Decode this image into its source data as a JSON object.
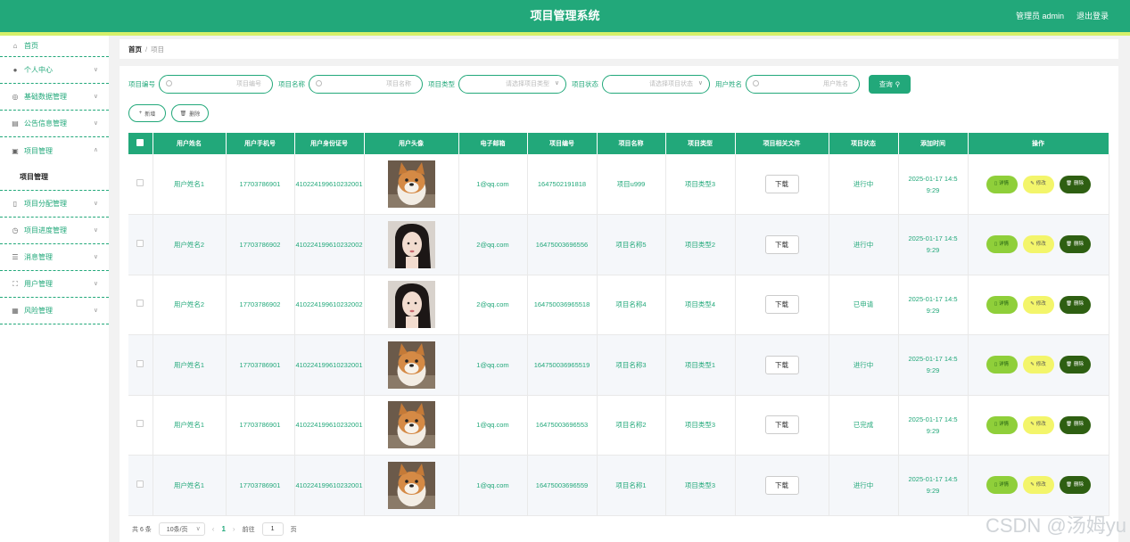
{
  "header": {
    "title": "项目管理系统",
    "user_label": "管理员 admin",
    "logout_label": "退出登录"
  },
  "sidebar": {
    "items": [
      {
        "label": "首页"
      },
      {
        "label": "个人中心"
      },
      {
        "label": "基础数据管理"
      },
      {
        "label": "公告信息管理"
      },
      {
        "label": "项目管理",
        "sub": "项目管理"
      },
      {
        "label": "项目分配管理"
      },
      {
        "label": "项目进度管理"
      },
      {
        "label": "消息管理"
      },
      {
        "label": "用户管理"
      },
      {
        "label": "风险管理"
      }
    ]
  },
  "breadcrumb": {
    "home": "首页",
    "sep": "/",
    "current": "项目"
  },
  "search": {
    "project_no_label": "项目编号",
    "project_no_placeholder": "项目编号",
    "project_name_label": "项目名称",
    "project_name_placeholder": "项目名称",
    "project_type_label": "项目类型",
    "project_type_placeholder": "请选择项目类型",
    "project_status_label": "项目状态",
    "project_status_placeholder": "请选择项目状态",
    "user_name_label": "用户姓名",
    "user_name_placeholder": "用户姓名",
    "query_label": "查询"
  },
  "actions": {
    "add_label": "新增",
    "delete_label": "删除"
  },
  "table": {
    "columns": [
      "用户姓名",
      "用户手机号",
      "用户身份证号",
      "用户头像",
      "电子邮箱",
      "项目编号",
      "项目名称",
      "项目类型",
      "项目相关文件",
      "项目状态",
      "添加时间",
      "操作"
    ],
    "download_label": "下载",
    "op_detail": "详情",
    "op_edit": "修改",
    "op_delete": "删除",
    "rows": [
      {
        "name": "用户姓名1",
        "phone": "17703786901",
        "id_card": "410224199610232001",
        "avatar": "shiba-dog-photo",
        "email": "1@qq.com",
        "project_no": "1647502191818",
        "project_name": "项目u999",
        "project_type": "项目类型3",
        "status": "进行中",
        "time": "2025-01-17 14:59:29"
      },
      {
        "name": "用户姓名2",
        "phone": "17703786902",
        "id_card": "410224199610232002",
        "avatar": "girl-portrait-photo",
        "email": "2@qq.com",
        "project_no": "16475003696556",
        "project_name": "项目名称5",
        "project_type": "项目类型2",
        "status": "进行中",
        "time": "2025-01-17 14:59:29"
      },
      {
        "name": "用户姓名2",
        "phone": "17703786902",
        "id_card": "410224199610232002",
        "avatar": "girl-portrait-photo",
        "email": "2@qq.com",
        "project_no": "164750036965518",
        "project_name": "项目名称4",
        "project_type": "项目类型4",
        "status": "已申请",
        "time": "2025-01-17 14:59:29"
      },
      {
        "name": "用户姓名1",
        "phone": "17703786901",
        "id_card": "410224199610232001",
        "avatar": "shiba-dog-photo",
        "email": "1@qq.com",
        "project_no": "164750036965519",
        "project_name": "项目名称3",
        "project_type": "项目类型1",
        "status": "进行中",
        "time": "2025-01-17 14:59:29"
      },
      {
        "name": "用户姓名1",
        "phone": "17703786901",
        "id_card": "410224199610232001",
        "avatar": "shiba-dog-photo",
        "email": "1@qq.com",
        "project_no": "16475003696553",
        "project_name": "项目名称2",
        "project_type": "项目类型3",
        "status": "已完成",
        "time": "2025-01-17 14:59:29"
      },
      {
        "name": "用户姓名1",
        "phone": "17703786901",
        "id_card": "410224199610232001",
        "avatar": "shiba-dog-photo",
        "email": "1@qq.com",
        "project_no": "16475003696559",
        "project_name": "项目名称1",
        "project_type": "项目类型3",
        "status": "进行中",
        "time": "2025-01-17 14:59:29"
      }
    ]
  },
  "pagination": {
    "total": "共 6 条",
    "page_size": "10条/页",
    "current_page": "1",
    "goto_label": "前往",
    "goto_value": "1",
    "page_suffix": "页"
  },
  "watermark": "CSDN @汤姆yu",
  "colors": {
    "primary": "#22a87a",
    "stripe": "#d6f06a",
    "detail": "#8fcf3a",
    "edit": "#f3f56b",
    "delete": "#2e5f12"
  }
}
